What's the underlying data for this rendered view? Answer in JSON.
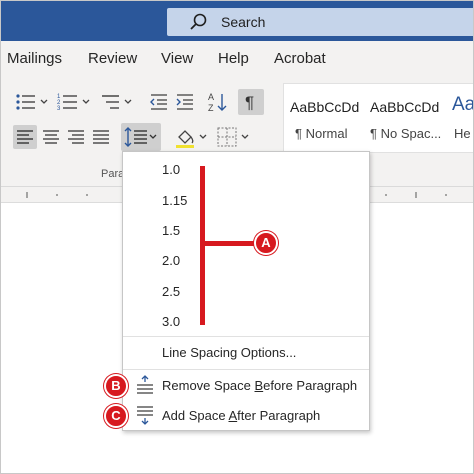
{
  "search": {
    "label": "Search"
  },
  "tabs": [
    "Mailings",
    "Review",
    "View",
    "Help",
    "Acrobat"
  ],
  "styles": {
    "samples": [
      "AaBbCcDd",
      "AaBbCcDd",
      "Aa"
    ],
    "names": [
      "¶ Normal",
      "¶ No Spac...",
      "He"
    ]
  },
  "ribbon": {
    "group_label": "Para"
  },
  "line_spacing_menu": {
    "options": [
      "1.0",
      "1.15",
      "1.5",
      "2.0",
      "2.5",
      "3.0"
    ],
    "more_options": "Line Spacing Options...",
    "remove_space": {
      "before": "Remove Space ",
      "key": "B",
      "after": "efore Paragraph"
    },
    "add_space": {
      "before": "Add Space ",
      "key": "A",
      "after": "fter Paragraph"
    }
  },
  "annotations": {
    "a": "A",
    "b": "B",
    "c": "C"
  },
  "colors": {
    "title_bar": "#2b579a",
    "search_box": "#c5d4ea",
    "annotation_red": "#d7191f",
    "ribbon_bg": "#f3f2f1"
  }
}
